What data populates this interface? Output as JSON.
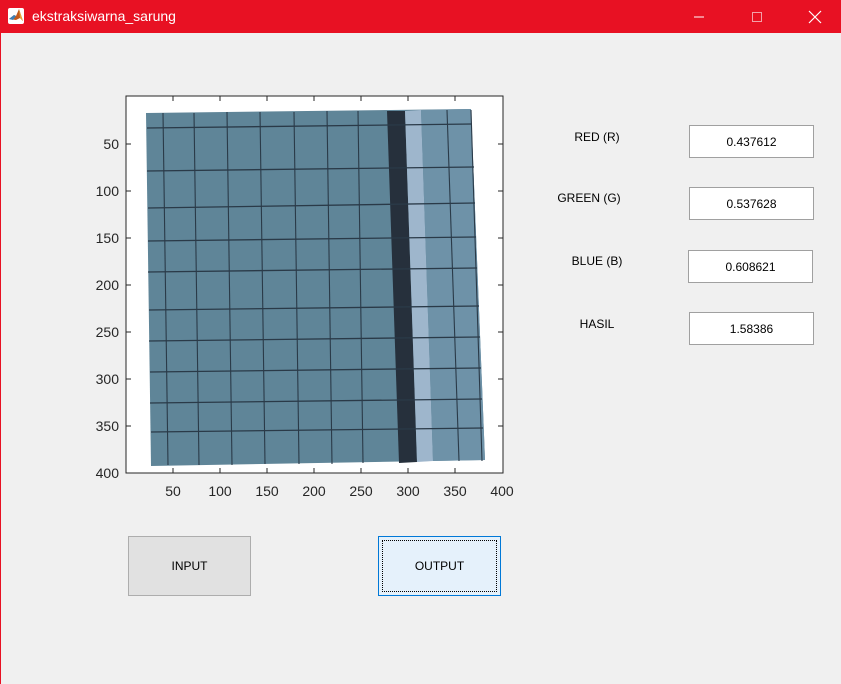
{
  "window": {
    "title": "ekstraksiwarna_sarung",
    "accent_color": "#e81123"
  },
  "axes": {
    "y_ticks": [
      "50",
      "100",
      "150",
      "200",
      "250",
      "300",
      "350",
      "400"
    ],
    "x_ticks": [
      "50",
      "100",
      "150",
      "200",
      "250",
      "300",
      "350",
      "400"
    ],
    "image_icon": "sarung-image"
  },
  "fields": {
    "red_label": "RED (R)",
    "red_value": "0.437612",
    "green_label": "GREEN (G)",
    "green_value": "0.537628",
    "blue_label": "BLUE (B)",
    "blue_value": "0.608621",
    "hasil_label": "HASIL",
    "hasil_value": "1.58386"
  },
  "buttons": {
    "input_label": "INPUT",
    "output_label": "OUTPUT"
  }
}
